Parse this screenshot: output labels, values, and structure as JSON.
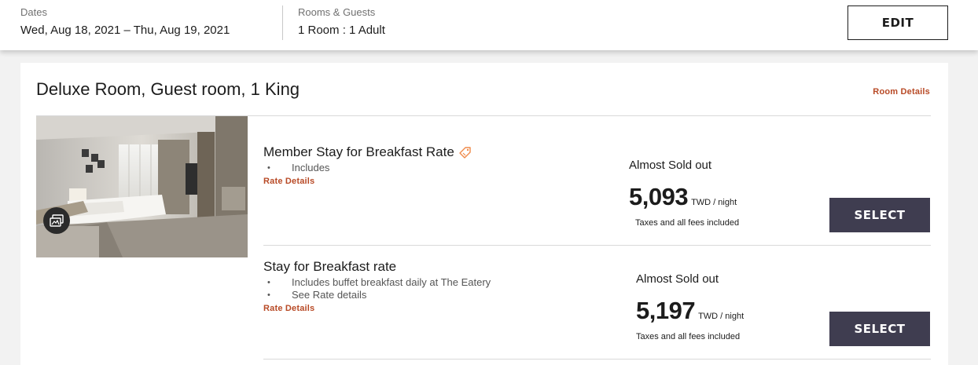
{
  "search_bar": {
    "dates_label": "Dates",
    "dates_value": "Wed, Aug 18, 2021 – Thu, Aug 19, 2021",
    "rooms_label": "Rooms & Guests",
    "rooms_value": "1 Room : 1 Adult",
    "edit_label": "EDIT"
  },
  "room": {
    "title": "Deluxe Room, Guest room, 1 King",
    "details_link": "Room Details",
    "photo_icon": "image-gallery-icon",
    "rates": [
      {
        "name": "Member Stay for Breakfast Rate",
        "badge_icon": "member-tag-icon",
        "bullets": [
          "Includes"
        ],
        "details_link": "Rate Details",
        "availability": "Almost Sold out",
        "price": "5,093",
        "unit": "TWD / night",
        "taxes": "Taxes and all fees included",
        "select_label": "SELECT"
      },
      {
        "name": "Stay for Breakfast rate",
        "bullets": [
          "Includes buffet breakfast daily at The Eatery",
          "See Rate details"
        ],
        "details_link": "Rate Details",
        "availability": "Almost Sold out",
        "price": "5,197",
        "unit": "TWD / night",
        "taxes": "Taxes and all fees included",
        "select_label": "SELECT"
      }
    ]
  },
  "colors": {
    "accent_link": "#b84a26",
    "select_button": "#3f3d50",
    "background": "#f2f2f2"
  }
}
